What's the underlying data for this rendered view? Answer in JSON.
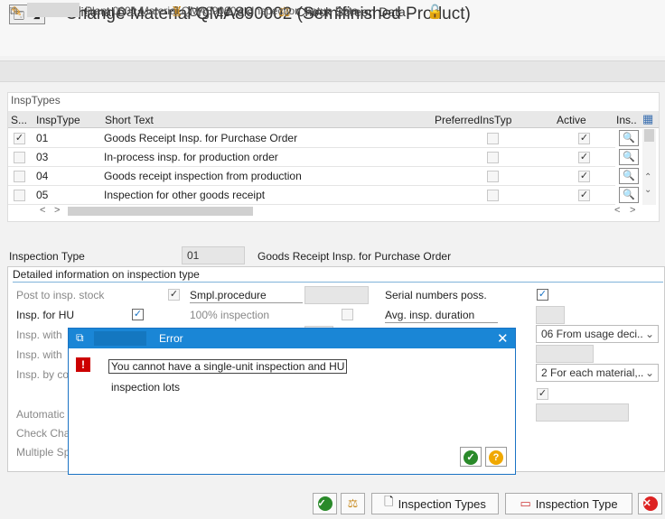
{
  "window": {
    "title": "Change Material QMA890002 (Semifinished Product)"
  },
  "toolbar": {
    "additional_data": "Additional Data",
    "org_levels": "Org. Levels",
    "check_screen_data": "Check Screen Data"
  },
  "infobar": {
    "text": "Plant 0001 Material QMA890002 : Inspection Setup Data"
  },
  "table": {
    "caption": "InspTypes",
    "headers": {
      "sel": "S...",
      "insptype": "InspType",
      "short_text": "Short Text",
      "preferred": "PreferredInsTyp",
      "active": "Active",
      "ins": "Ins.."
    },
    "rows": [
      {
        "insptype": "01",
        "short_text": "Goods Receipt Insp. for Purchase Order",
        "selected": true,
        "preferred": false,
        "active": true
      },
      {
        "insptype": "03",
        "short_text": "In-process insp. for production order",
        "selected": false,
        "preferred": false,
        "active": true
      },
      {
        "insptype": "04",
        "short_text": "Goods receipt inspection from production",
        "selected": false,
        "preferred": false,
        "active": true
      },
      {
        "insptype": "05",
        "short_text": "Inspection for other goods receipt",
        "selected": false,
        "preferred": false,
        "active": true
      }
    ]
  },
  "inspection_type": {
    "label": "Inspection Type",
    "value": "01",
    "description": "Goods Receipt Insp. for Purchase Order"
  },
  "detail": {
    "title": "Detailed information on inspection type",
    "post_to_insp_stock": "Post to insp. stock",
    "smpl_procedure": "Smpl.procedure",
    "serial_numbers_poss": "Serial numbers poss.",
    "insp_for_hu": "Insp. for HU",
    "inspection_100": "100% inspection",
    "avg_insp_duration": "Avg. insp. duration",
    "insp_with_1": "Insp. with",
    "insp_with_2": "Insp. with",
    "insp_by_co": "Insp. by co",
    "automatic": "Automatic",
    "check_char": "Check Char",
    "multiple_spe": "Multiple Spe",
    "dropdown_1": "06 From usage deci..",
    "dropdown_2": "2 For each material,.."
  },
  "dialog": {
    "title": "Error",
    "message_line1": "You cannot have a single-unit inspection and HU",
    "message_line2": "inspection lots"
  },
  "footer": {
    "inspection_types": "Inspection Types",
    "inspection_type": "Inspection Type"
  }
}
